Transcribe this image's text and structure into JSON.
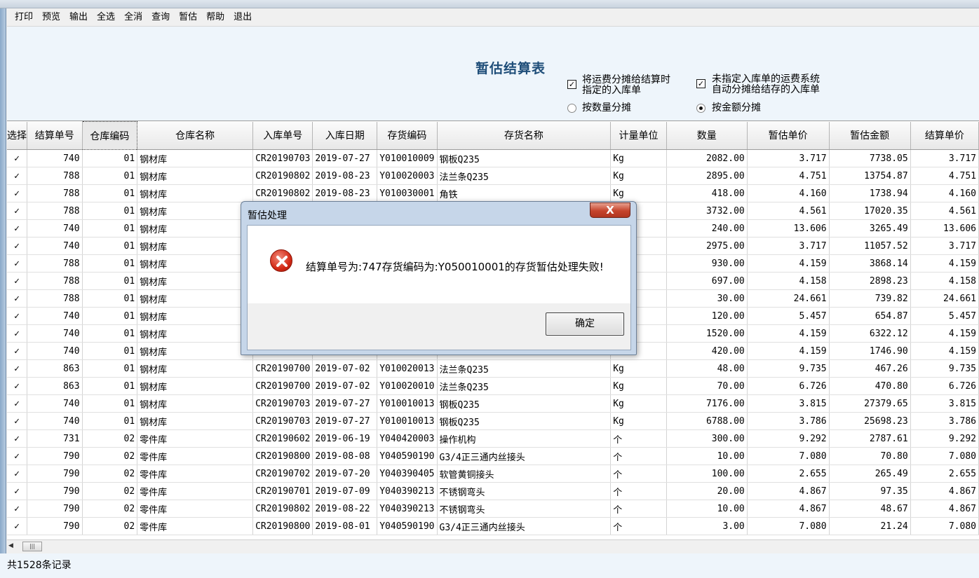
{
  "toolbar": {
    "items": [
      "打印",
      "预览",
      "输出",
      "全选",
      "全消",
      "查询",
      "暂估",
      "帮助",
      "退出"
    ]
  },
  "report": {
    "title": "暂估结算表",
    "option_alloc_line1": "将运费分摊给结算时",
    "option_alloc_line2": "指定的入库单",
    "option_auto_line1": "未指定入库单的运费系统",
    "option_auto_line2": "自动分摊给结存的入库单",
    "radio_qty": "按数量分摊",
    "radio_amount": "按金额分摊",
    "check_mark": "✓"
  },
  "grid": {
    "columns": [
      "选择",
      "结算单号",
      "仓库编码",
      "仓库名称",
      "入库单号",
      "入库日期",
      "存货编码",
      "存货名称",
      "计量单位",
      "数量",
      "暂估单价",
      "暂估金额",
      "结算单价"
    ],
    "rows": [
      [
        "✓",
        "740",
        "01",
        "钢材库",
        "CR20190703",
        "2019-07-27",
        "Y010010009",
        "钢板Q235",
        "Kg",
        "2082.00",
        "3.717",
        "7738.05",
        "3.717"
      ],
      [
        "✓",
        "788",
        "01",
        "钢材库",
        "CR20190802",
        "2019-08-23",
        "Y010020003",
        "法兰条Q235",
        "Kg",
        "2895.00",
        "4.751",
        "13754.87",
        "4.751"
      ],
      [
        "✓",
        "788",
        "01",
        "钢材库",
        "CR20190802",
        "2019-08-23",
        "Y010030001",
        "角铁",
        "Kg",
        "418.00",
        "4.160",
        "1738.94",
        "4.160"
      ],
      [
        "✓",
        "788",
        "01",
        "钢材库",
        "",
        "",
        "",
        "",
        "",
        "3732.00",
        "4.561",
        "17020.35",
        "4.561"
      ],
      [
        "✓",
        "740",
        "01",
        "钢材库",
        "",
        "",
        "",
        "",
        "",
        "240.00",
        "13.606",
        "3265.49",
        "13.606"
      ],
      [
        "✓",
        "740",
        "01",
        "钢材库",
        "",
        "",
        "",
        "",
        "",
        "2975.00",
        "3.717",
        "11057.52",
        "3.717"
      ],
      [
        "✓",
        "788",
        "01",
        "钢材库",
        "",
        "",
        "",
        "",
        "",
        "930.00",
        "4.159",
        "3868.14",
        "4.159"
      ],
      [
        "✓",
        "788",
        "01",
        "钢材库",
        "",
        "",
        "",
        "",
        "",
        "697.00",
        "4.158",
        "2898.23",
        "4.158"
      ],
      [
        "✓",
        "788",
        "01",
        "钢材库",
        "",
        "",
        "",
        "",
        "",
        "30.00",
        "24.661",
        "739.82",
        "24.661"
      ],
      [
        "✓",
        "740",
        "01",
        "钢材库",
        "",
        "",
        "",
        "",
        "",
        "120.00",
        "5.457",
        "654.87",
        "5.457"
      ],
      [
        "✓",
        "740",
        "01",
        "钢材库",
        "",
        "",
        "",
        "",
        "",
        "1520.00",
        "4.159",
        "6322.12",
        "4.159"
      ],
      [
        "✓",
        "740",
        "01",
        "钢材库",
        "",
        "",
        "",
        "",
        "",
        "420.00",
        "4.159",
        "1746.90",
        "4.159"
      ],
      [
        "✓",
        "863",
        "01",
        "钢材库",
        "CR20190700",
        "2019-07-02",
        "Y010020013",
        "法兰条Q235",
        "Kg",
        "48.00",
        "9.735",
        "467.26",
        "9.735"
      ],
      [
        "✓",
        "863",
        "01",
        "钢材库",
        "CR20190700",
        "2019-07-02",
        "Y010020010",
        "法兰条Q235",
        "Kg",
        "70.00",
        "6.726",
        "470.80",
        "6.726"
      ],
      [
        "✓",
        "740",
        "01",
        "钢材库",
        "CR20190703",
        "2019-07-27",
        "Y010010013",
        "钢板Q235",
        "Kg",
        "7176.00",
        "3.815",
        "27379.65",
        "3.815"
      ],
      [
        "✓",
        "740",
        "01",
        "钢材库",
        "CR20190703",
        "2019-07-27",
        "Y010010013",
        "钢板Q235",
        "Kg",
        "6788.00",
        "3.786",
        "25698.23",
        "3.786"
      ],
      [
        "✓",
        "731",
        "02",
        "零件库",
        "CR20190602",
        "2019-06-19",
        "Y040420003",
        "操作机构",
        "个",
        "300.00",
        "9.292",
        "2787.61",
        "9.292"
      ],
      [
        "✓",
        "790",
        "02",
        "零件库",
        "CR20190800",
        "2019-08-08",
        "Y040590190",
        "G3/4正三通内丝接头",
        "个",
        "10.00",
        "7.080",
        "70.80",
        "7.080"
      ],
      [
        "✓",
        "790",
        "02",
        "零件库",
        "CR20190702",
        "2019-07-20",
        "Y040390405",
        "软管黄铜接头",
        "个",
        "100.00",
        "2.655",
        "265.49",
        "2.655"
      ],
      [
        "✓",
        "790",
        "02",
        "零件库",
        "CR20190701",
        "2019-07-09",
        "Y040390213",
        "不锈钢弯头",
        "个",
        "20.00",
        "4.867",
        "97.35",
        "4.867"
      ],
      [
        "✓",
        "790",
        "02",
        "零件库",
        "CR20190802",
        "2019-08-22",
        "Y040390213",
        "不锈钢弯头",
        "个",
        "10.00",
        "4.867",
        "48.67",
        "4.867"
      ],
      [
        "✓",
        "790",
        "02",
        "零件库",
        "CR20190800",
        "2019-08-01",
        "Y040590190",
        "G3/4正三通内丝接头",
        "个",
        "3.00",
        "7.080",
        "21.24",
        "7.080"
      ]
    ]
  },
  "status": {
    "record_count": "共1528条记录"
  },
  "dialog": {
    "title": "暂估处理",
    "close_glyph": "X",
    "message": "结算单号为:747存货编码为:Y050010001的存货暂估处理失败!",
    "ok_label": "确定",
    "icon": "error-icon"
  }
}
